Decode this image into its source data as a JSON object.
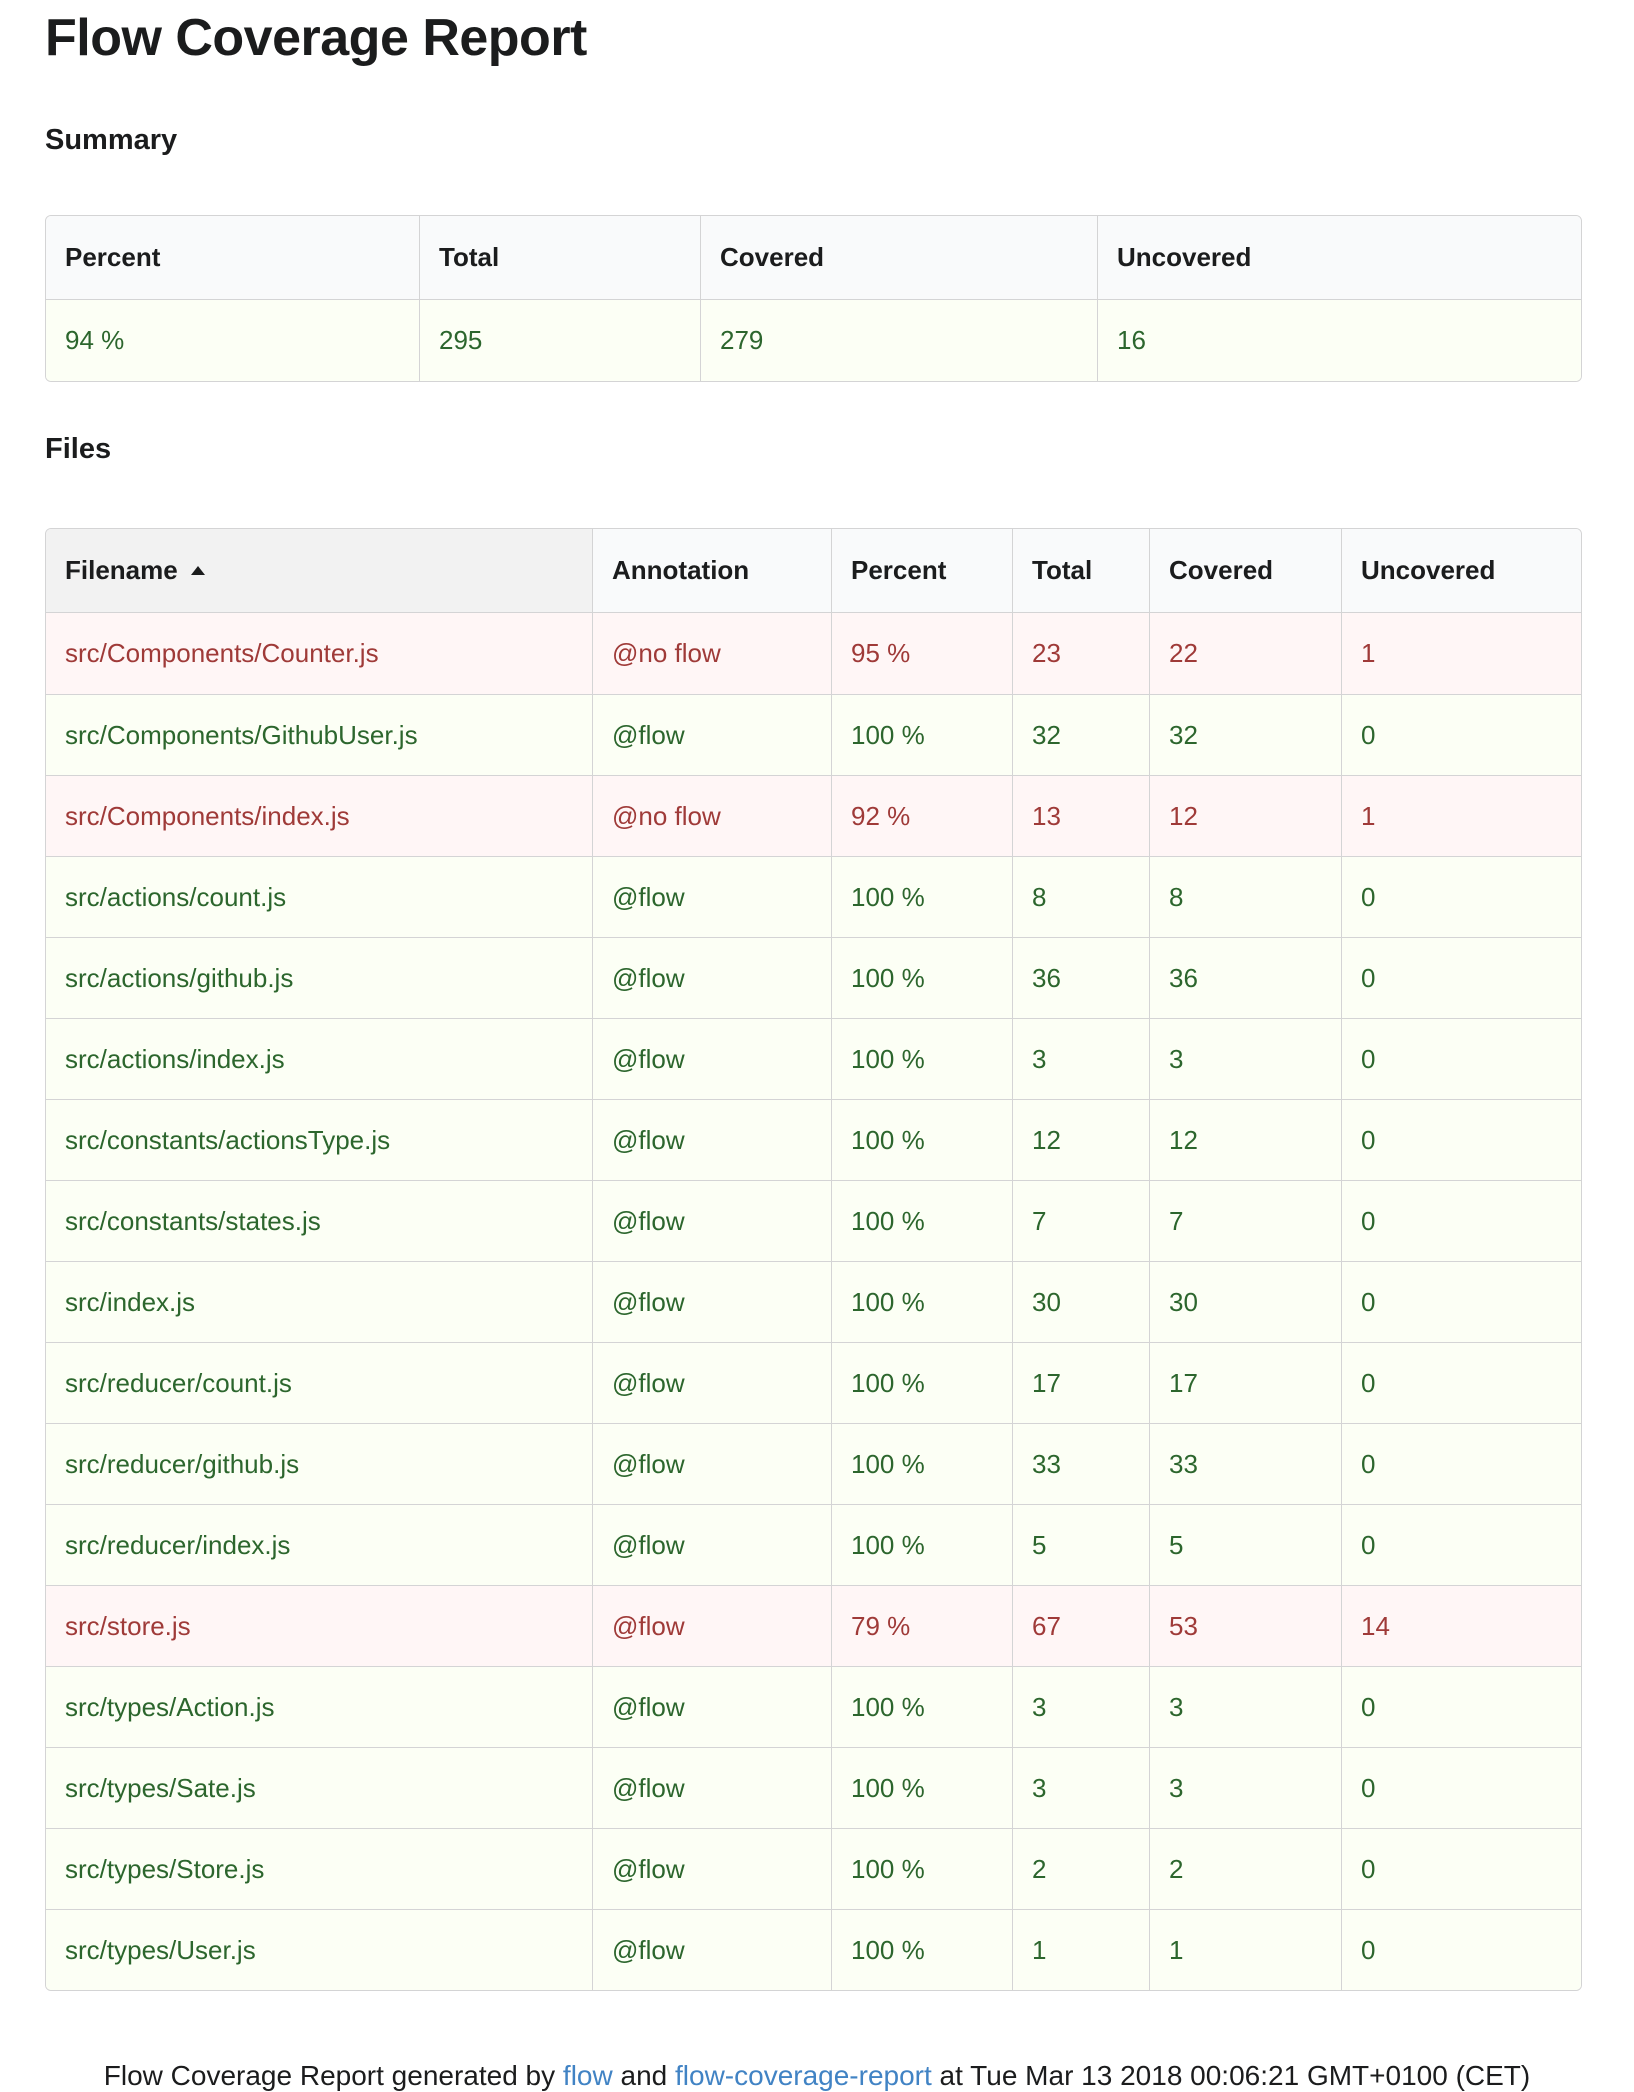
{
  "title": "Flow Coverage Report",
  "summary": {
    "heading": "Summary",
    "headers": [
      "Percent",
      "Total",
      "Covered",
      "Uncovered"
    ],
    "row": [
      "94 %",
      "295",
      "279",
      "16"
    ]
  },
  "files": {
    "heading": "Files",
    "headers": [
      "Filename",
      "Annotation",
      "Percent",
      "Total",
      "Covered",
      "Uncovered"
    ],
    "sort_icon": "caret-up-icon",
    "rows": [
      {
        "filename": "src/Components/Counter.js",
        "annotation": "@no flow",
        "percent": "95 %",
        "total": "23",
        "covered": "22",
        "uncovered": "1",
        "status": "negative"
      },
      {
        "filename": "src/Components/GithubUser.js",
        "annotation": "@flow",
        "percent": "100 %",
        "total": "32",
        "covered": "32",
        "uncovered": "0",
        "status": "positive"
      },
      {
        "filename": "src/Components/index.js",
        "annotation": "@no flow",
        "percent": "92 %",
        "total": "13",
        "covered": "12",
        "uncovered": "1",
        "status": "negative"
      },
      {
        "filename": "src/actions/count.js",
        "annotation": "@flow",
        "percent": "100 %",
        "total": "8",
        "covered": "8",
        "uncovered": "0",
        "status": "positive"
      },
      {
        "filename": "src/actions/github.js",
        "annotation": "@flow",
        "percent": "100 %",
        "total": "36",
        "covered": "36",
        "uncovered": "0",
        "status": "positive"
      },
      {
        "filename": "src/actions/index.js",
        "annotation": "@flow",
        "percent": "100 %",
        "total": "3",
        "covered": "3",
        "uncovered": "0",
        "status": "positive"
      },
      {
        "filename": "src/constants/actionsType.js",
        "annotation": "@flow",
        "percent": "100 %",
        "total": "12",
        "covered": "12",
        "uncovered": "0",
        "status": "positive"
      },
      {
        "filename": "src/constants/states.js",
        "annotation": "@flow",
        "percent": "100 %",
        "total": "7",
        "covered": "7",
        "uncovered": "0",
        "status": "positive"
      },
      {
        "filename": "src/index.js",
        "annotation": "@flow",
        "percent": "100 %",
        "total": "30",
        "covered": "30",
        "uncovered": "0",
        "status": "positive"
      },
      {
        "filename": "src/reducer/count.js",
        "annotation": "@flow",
        "percent": "100 %",
        "total": "17",
        "covered": "17",
        "uncovered": "0",
        "status": "positive"
      },
      {
        "filename": "src/reducer/github.js",
        "annotation": "@flow",
        "percent": "100 %",
        "total": "33",
        "covered": "33",
        "uncovered": "0",
        "status": "positive"
      },
      {
        "filename": "src/reducer/index.js",
        "annotation": "@flow",
        "percent": "100 %",
        "total": "5",
        "covered": "5",
        "uncovered": "0",
        "status": "positive"
      },
      {
        "filename": "src/store.js",
        "annotation": "@flow",
        "percent": "79 %",
        "total": "67",
        "covered": "53",
        "uncovered": "14",
        "status": "negative"
      },
      {
        "filename": "src/types/Action.js",
        "annotation": "@flow",
        "percent": "100 %",
        "total": "3",
        "covered": "3",
        "uncovered": "0",
        "status": "positive"
      },
      {
        "filename": "src/types/Sate.js",
        "annotation": "@flow",
        "percent": "100 %",
        "total": "3",
        "covered": "3",
        "uncovered": "0",
        "status": "positive"
      },
      {
        "filename": "src/types/Store.js",
        "annotation": "@flow",
        "percent": "100 %",
        "total": "2",
        "covered": "2",
        "uncovered": "0",
        "status": "positive"
      },
      {
        "filename": "src/types/User.js",
        "annotation": "@flow",
        "percent": "100 %",
        "total": "1",
        "covered": "1",
        "uncovered": "0",
        "status": "positive"
      }
    ]
  },
  "footer": {
    "prefix": "Flow Coverage Report generated by ",
    "link1": "flow",
    "middle": " and ",
    "link2": "flow-coverage-report",
    "suffix": " at Tue Mar 13 2018 00:06:21 GMT+0100 (CET)"
  },
  "colors": {
    "positive_text": "#2c662d",
    "positive_bg": "#fcfff5",
    "negative_text": "#9f3a38",
    "negative_bg": "#fff6f6",
    "link": "#4183c4"
  }
}
